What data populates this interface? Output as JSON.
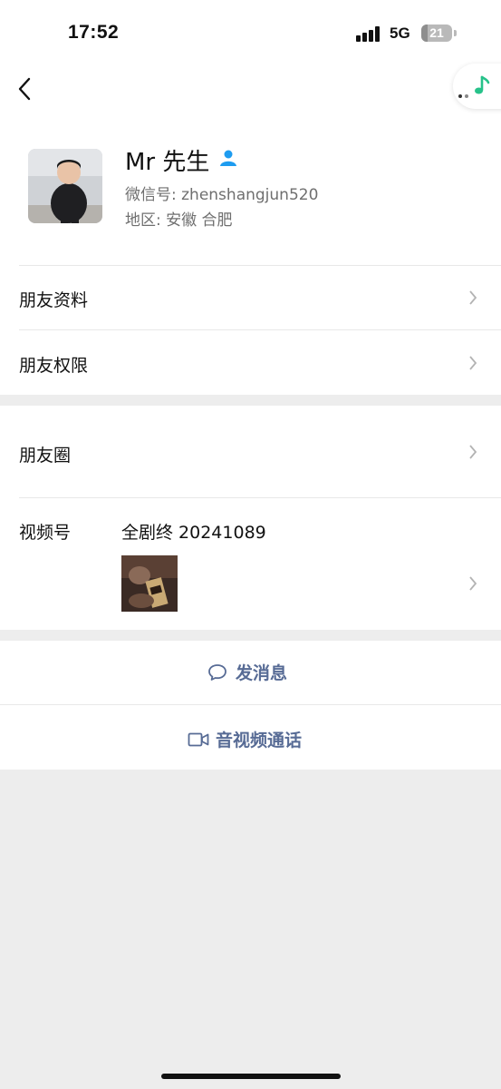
{
  "status_bar": {
    "time": "17:52",
    "network": "5G",
    "battery": "21",
    "battery_level": 0.21
  },
  "nav": {
    "back_icon": "chevron-left-icon",
    "more_icon": "more-dots-icon",
    "music_icon": "music-note-icon"
  },
  "profile": {
    "nickname": "Mr 先生",
    "wechat_id": "微信号: zhenshangjun520",
    "region": "地区: 安徽 合肥",
    "verified_icon": "person-icon"
  },
  "menu": {
    "friend_info": "朋友资料",
    "friend_permissions": "朋友权限",
    "moments": "朋友圈",
    "channels": "视频号",
    "channels_value": "全剧终 20241089"
  },
  "actions": {
    "send_message": "发消息",
    "video_call": "音视频通话"
  },
  "colors": {
    "link": "#576b95",
    "accent_icon": "#1e9cf0",
    "background": "#ededed"
  }
}
